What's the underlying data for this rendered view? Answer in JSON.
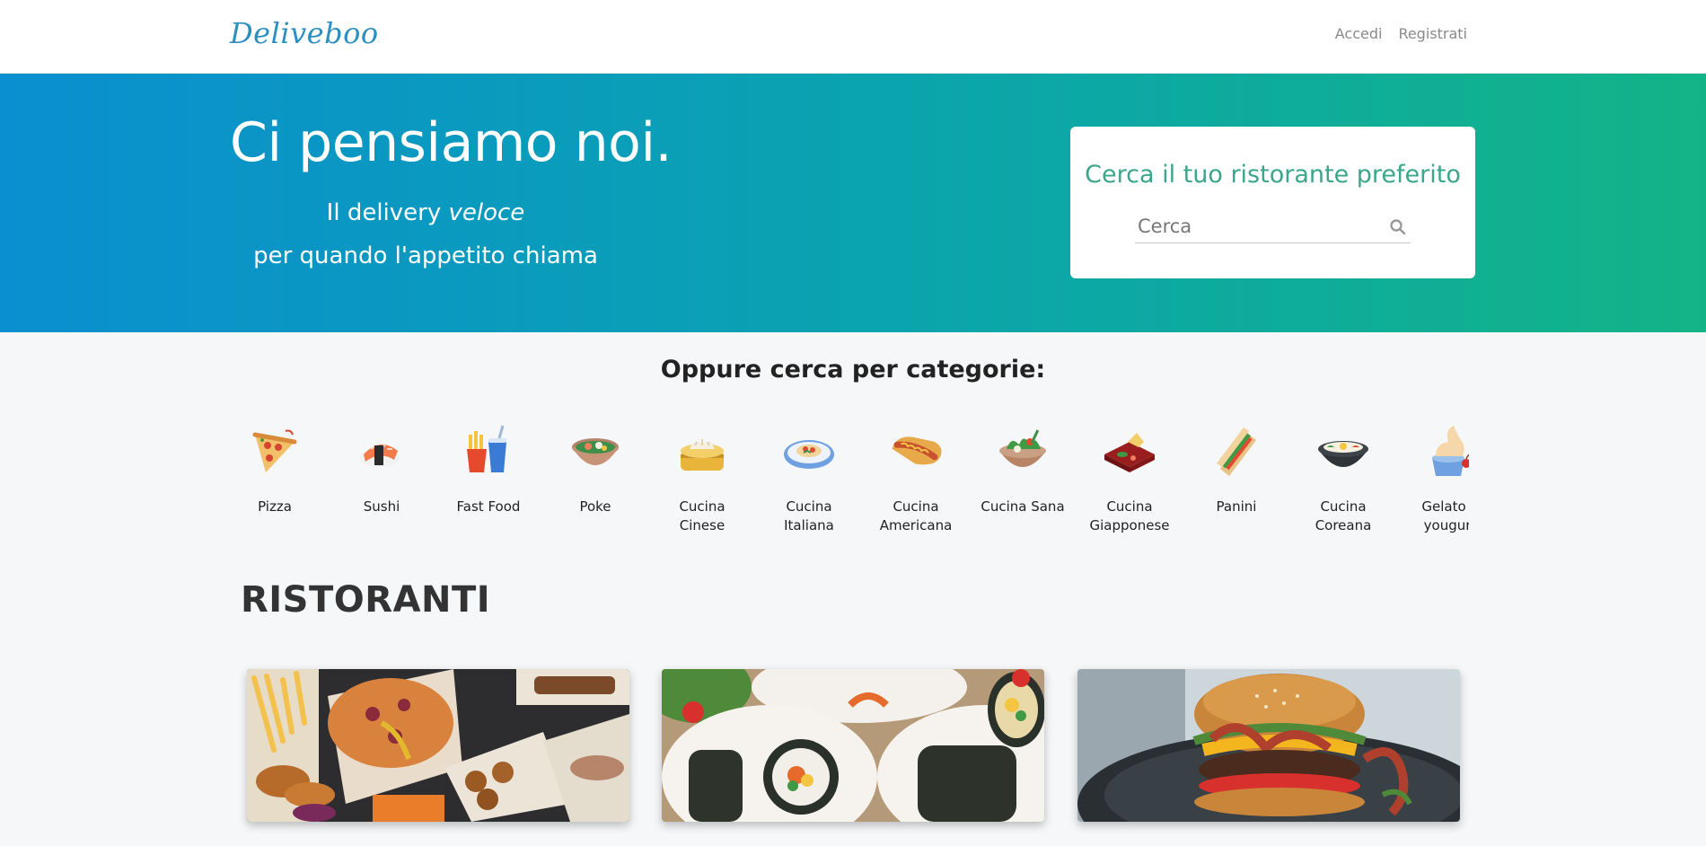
{
  "navbar": {
    "brand": "Deliveboo",
    "links": [
      {
        "label": "Accedi"
      },
      {
        "label": "Registrati"
      }
    ]
  },
  "hero": {
    "title": "Ci pensiamo noi.",
    "subtitle_prefix": "Il delivery ",
    "subtitle_emphasis": "veloce",
    "subtitle_line2": "per quando l'appetito chiama",
    "search": {
      "title": "Cerca il tuo ristorante preferito",
      "placeholder": "Cerca",
      "icon": "search-icon"
    }
  },
  "categories": {
    "heading": "Oppure cerca per categorie:",
    "items": [
      {
        "label": "Pizza",
        "icon": "pizza-icon"
      },
      {
        "label": "Sushi",
        "icon": "sushi-icon"
      },
      {
        "label": "Fast Food",
        "icon": "fast-food-icon"
      },
      {
        "label": "Poke",
        "icon": "poke-icon"
      },
      {
        "label": "Cucina Cinese",
        "icon": "dim-sum-icon"
      },
      {
        "label": "Cucina Italiana",
        "icon": "italian-dish-icon"
      },
      {
        "label": "Cucina Americana",
        "icon": "hot-dog-icon"
      },
      {
        "label": "Cucina Sana",
        "icon": "salad-bowl-icon"
      },
      {
        "label": "Cucina Giapponese",
        "icon": "bento-icon"
      },
      {
        "label": "Panini",
        "icon": "sandwich-icon"
      },
      {
        "label": "Cucina Coreana",
        "icon": "bibimbap-icon"
      },
      {
        "label": "Gelato e yougurt",
        "icon": "ice-cream-icon"
      }
    ]
  },
  "restaurants": {
    "heading": "RISTORANTI",
    "cards": [
      {
        "image": "pizza-platter-photo"
      },
      {
        "image": "sushi-rolls-photo"
      },
      {
        "image": "bacon-burger-photo"
      }
    ]
  },
  "colors": {
    "brand": "#2b8fc0",
    "hero_gradient_start": "#0a8fd0",
    "hero_gradient_end": "#12b487",
    "search_title": "#3ba68c"
  }
}
